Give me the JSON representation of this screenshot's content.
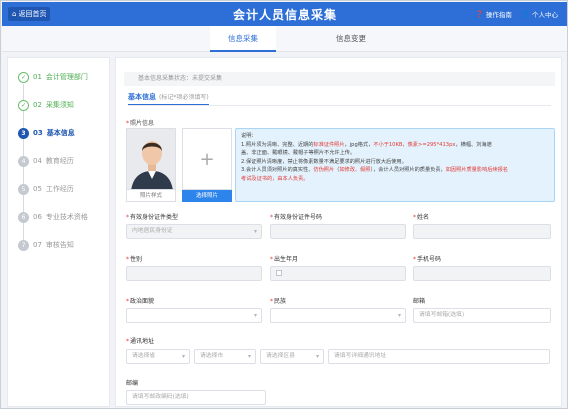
{
  "header": {
    "home_label": "返回首页",
    "title": "会计人员信息采集",
    "guide_label": "操作指南",
    "user_label": "个人中心"
  },
  "tabs": [
    {
      "label": "信息采集",
      "active": true
    },
    {
      "label": "信息变更",
      "active": false
    }
  ],
  "steps": [
    {
      "num": "01",
      "label": "会计管理部门",
      "state": "done"
    },
    {
      "num": "02",
      "label": "采集须知",
      "state": "done"
    },
    {
      "num": "03",
      "label": "基本信息",
      "state": "current"
    },
    {
      "num": "04",
      "label": "教育经历",
      "state": "todo"
    },
    {
      "num": "05",
      "label": "工作经历",
      "state": "todo"
    },
    {
      "num": "06",
      "label": "专业技术资格",
      "state": "todo"
    },
    {
      "num": "07",
      "label": "审核告知",
      "state": "todo"
    }
  ],
  "main": {
    "status_text": "基本信息采集状态：未提交采集",
    "section_tab": "基本信息",
    "section_note": "(标记*项必须填写)",
    "photo_label": "照片信息",
    "photo_caption": "照片样式",
    "upload_label": "选择照片",
    "notice": {
      "title": "说明：",
      "l1a": "1.照片须为清晰、完整、近期的",
      "l1b": "标准证件照片",
      "l1c": "，jpg格式，",
      "l1d": "不小于10KB，像素>=295*413px",
      "l1e": "，横幅、刘海遮",
      "l2": "盖、非正面、戴眼镜、戴帽子等照片不允许上传。",
      "l3": "2.保证照片清晰度，禁止将像素数量不满足要求的照片进行放大后使用。",
      "l4a": "3.会计人员须对照片的真实性、",
      "l4b": "仿伪照片",
      "l4c": "（",
      "l4d": "如修改、假照",
      "l4e": "），会计人员对照片的质量负责，",
      "l4f": "如因照片质量影响后续报名",
      "l5": "考试及证书的，由本人负责。"
    },
    "fields": {
      "id_type_label": "有效身份证件类型",
      "id_type_value": "内地居民身份证",
      "id_no_label": "有效身份证件号码",
      "id_no_value": "",
      "name_label": "姓名",
      "name_value": "",
      "gender_label": "性别",
      "gender_value": "",
      "birth_label": "出生年月",
      "birth_value": "",
      "mobile_label": "手机号码",
      "mobile_value": "",
      "politics_label": "政治面貌",
      "politics_value": "",
      "nation_label": "民族",
      "nation_value": "",
      "email_label": "邮箱",
      "email_placeholder": "请填写邮箱(选填)",
      "address_label": "通讯地址",
      "province_placeholder": "请选择省",
      "city_placeholder": "请选择市",
      "district_placeholder": "请选择区县",
      "detail_placeholder": "请填写详细通讯地址",
      "postcode_label": "邮编",
      "postcode_placeholder": "请填写邮政编码(选填)"
    }
  }
}
